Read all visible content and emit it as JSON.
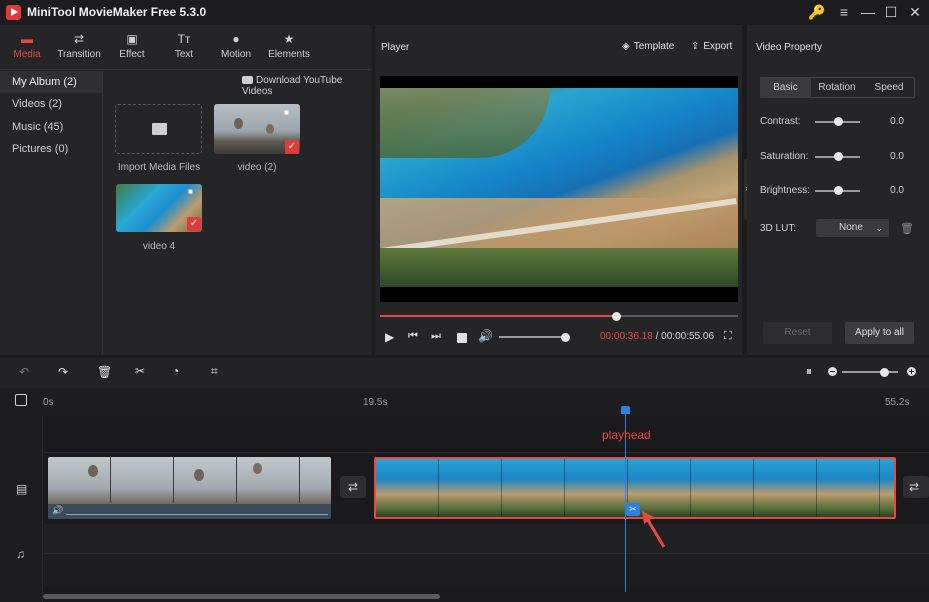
{
  "app": {
    "title": "MiniTool MovieMaker Free 5.3.0"
  },
  "window_controls": {
    "key": "🔑",
    "menu": "≡",
    "minimize": "—",
    "maximize": "☐",
    "close": "✕"
  },
  "toolbar": {
    "tabs": [
      {
        "label": "Media",
        "icon": "folder-icon",
        "glyph": "▬"
      },
      {
        "label": "Transition",
        "icon": "transition-icon",
        "glyph": "⇄"
      },
      {
        "label": "Effect",
        "icon": "effect-icon",
        "glyph": "▣"
      },
      {
        "label": "Text",
        "icon": "text-icon",
        "glyph": "Tт"
      },
      {
        "label": "Motion",
        "icon": "motion-icon",
        "glyph": "●"
      },
      {
        "label": "Elements",
        "icon": "elements-icon",
        "glyph": "★"
      }
    ]
  },
  "sidebar": {
    "items": [
      {
        "label": "My Album (2)"
      },
      {
        "label": "Videos (2)"
      },
      {
        "label": "Music (45)"
      },
      {
        "label": "Pictures (0)"
      }
    ]
  },
  "media": {
    "download_label": "Download YouTube Videos",
    "import_label": "Import Media Files",
    "items": [
      {
        "label": "video (2)"
      },
      {
        "label": "video 4"
      }
    ]
  },
  "player": {
    "title": "Player",
    "template_label": "Template",
    "export_label": "Export",
    "progress": 0.66,
    "volume": 1.0,
    "current_time": "00:00:36.18",
    "separator": " / ",
    "total_time": "00:00:55.06"
  },
  "properties": {
    "title": "Video Property",
    "tabs": [
      "Basic",
      "Rotation",
      "Speed"
    ],
    "contrast_label": "Contrast:",
    "contrast_value": "0.0",
    "saturation_label": "Saturation:",
    "saturation_value": "0.0",
    "brightness_label": "Brightness:",
    "brightness_value": "0.0",
    "lut_label": "3D LUT:",
    "lut_value": "None",
    "reset_label": "Reset",
    "apply_label": "Apply to all"
  },
  "timeline": {
    "ruler": [
      "0s",
      "19.5s",
      "55.2s"
    ],
    "playhead_label": "playhead",
    "zoom_level": 0.75
  },
  "colors": {
    "accent": "#e8483f",
    "playhead": "#2d7fe0",
    "clip_border": "#e8483f"
  }
}
